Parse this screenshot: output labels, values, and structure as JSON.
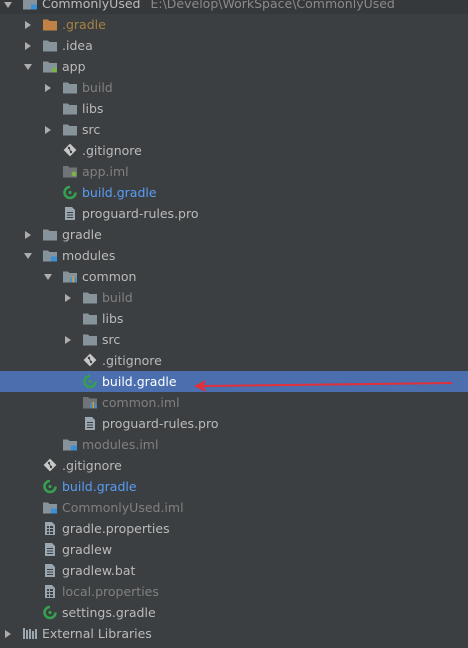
{
  "project": {
    "name": "CommonlyUsed",
    "path": "E:\\Develop\\WorkSpace\\CommonlyUsed"
  },
  "tree": {
    "gradle_hidden": ".gradle",
    "idea": ".idea",
    "app": {
      "label": "app",
      "build": "build",
      "libs": "libs",
      "src": "src",
      "gitignore": ".gitignore",
      "iml": "app.iml",
      "build_gradle": "build.gradle",
      "proguard": "proguard-rules.pro"
    },
    "gradle": "gradle",
    "modules": {
      "label": "modules",
      "common": {
        "label": "common",
        "build": "build",
        "libs": "libs",
        "src": "src",
        "gitignore": ".gitignore",
        "build_gradle": "build.gradle",
        "iml": "common.iml",
        "proguard": "proguard-rules.pro"
      },
      "iml": "modules.iml"
    },
    "gitignore": ".gitignore",
    "build_gradle": "build.gradle",
    "iml": "CommonlyUsed.iml",
    "gradle_properties": "gradle.properties",
    "gradlew": "gradlew",
    "gradlew_bat": "gradlew.bat",
    "local_properties": "local.properties",
    "settings_gradle": "settings.gradle",
    "external_libraries": "External Libraries"
  },
  "colors": {
    "background": "#3c3f41",
    "selection": "#4b6eaf",
    "folder": "#87939a",
    "gradle_icon": "#35a04f",
    "annotation_arrow": "#e0303a"
  }
}
